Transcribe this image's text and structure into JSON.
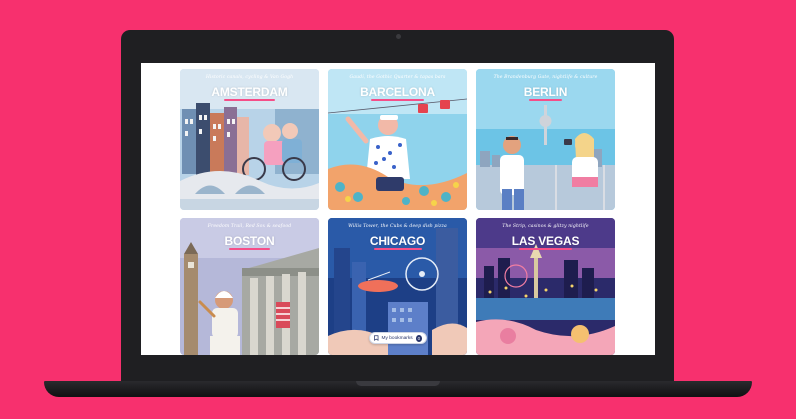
{
  "cards": [
    {
      "city": "AMSTERDAM",
      "tagline": "Historic canals, cycling & Van Gogh"
    },
    {
      "city": "BARCELONA",
      "tagline": "Gaudí, the Gothic Quarter & tapas bars"
    },
    {
      "city": "BERLIN",
      "tagline": "The Brandenburg Gate, nightlife & culture"
    },
    {
      "city": "BOSTON",
      "tagline": "Freedom Trail, Red Sox & seafood"
    },
    {
      "city": "CHICAGO",
      "tagline": "Willis Tower, the Cubs & deep dish pizza"
    },
    {
      "city": "LAS VEGAS",
      "tagline": "The Strip, casinos & glitzy nightlife"
    }
  ],
  "bookmarks": {
    "label": "My bookmarks",
    "count": "0"
  },
  "colors": {
    "background": "#f7306e",
    "accent": "#f54e88",
    "pill_text": "#27346a"
  }
}
